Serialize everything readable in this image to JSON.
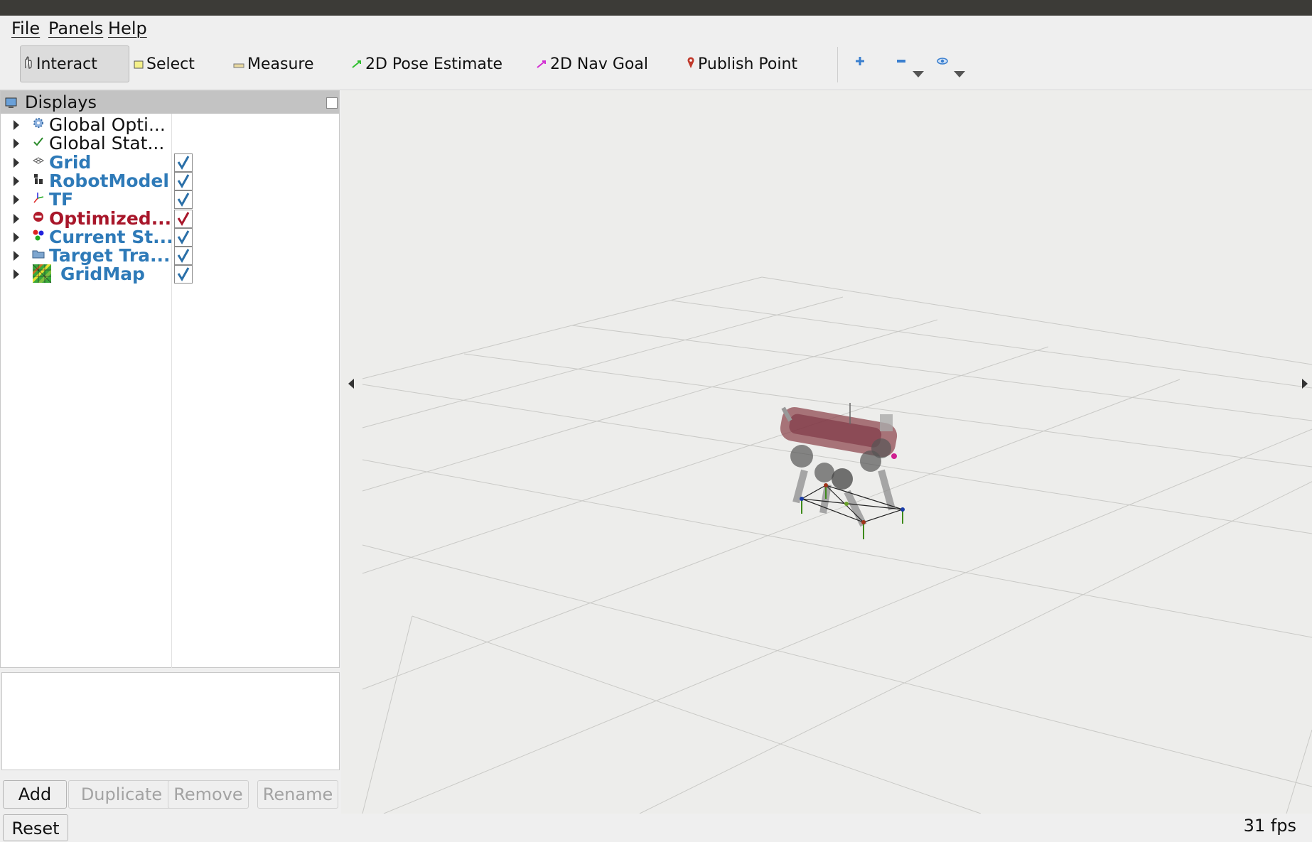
{
  "menu": {
    "file": "File",
    "panels": "Panels",
    "help": "Help"
  },
  "toolbar": {
    "interact": "Interact",
    "select": "Select",
    "measure": "Measure",
    "pose_estimate": "2D Pose Estimate",
    "nav_goal": "2D Nav Goal",
    "publish_point": "Publish Point"
  },
  "displays": {
    "title": "Displays",
    "items": [
      {
        "label": "Global Opti...",
        "icon": "gear-icon",
        "style": "normal",
        "checked": null
      },
      {
        "label": "Global Stat...",
        "icon": "checkmark-icon",
        "style": "normal",
        "checked": null
      },
      {
        "label": "Grid",
        "icon": "grid-icon",
        "style": "bold",
        "checked": true
      },
      {
        "label": "RobotModel",
        "icon": "robot-icon",
        "style": "bold",
        "checked": true
      },
      {
        "label": "TF",
        "icon": "tf-axes-icon",
        "style": "bold",
        "checked": true
      },
      {
        "label": "Optimized...",
        "icon": "error-icon",
        "style": "error",
        "checked": true
      },
      {
        "label": "Current St...",
        "icon": "markers-icon",
        "style": "bold",
        "checked": true
      },
      {
        "label": "Target Tra...",
        "icon": "folder-icon",
        "style": "bold",
        "checked": true
      },
      {
        "label": "GridMap",
        "icon": "gridmap-icon",
        "style": "bold",
        "checked": true
      }
    ]
  },
  "buttons": {
    "add": "Add",
    "duplicate": "Duplicate",
    "remove": "Remove",
    "rename": "Rename",
    "reset": "Reset"
  },
  "status": {
    "fps": "31 fps"
  },
  "colors": {
    "link_blue": "#2e7ab8",
    "error_red": "#a8162a",
    "check_blue": "#2a6fa8",
    "check_red": "#a8162a"
  }
}
